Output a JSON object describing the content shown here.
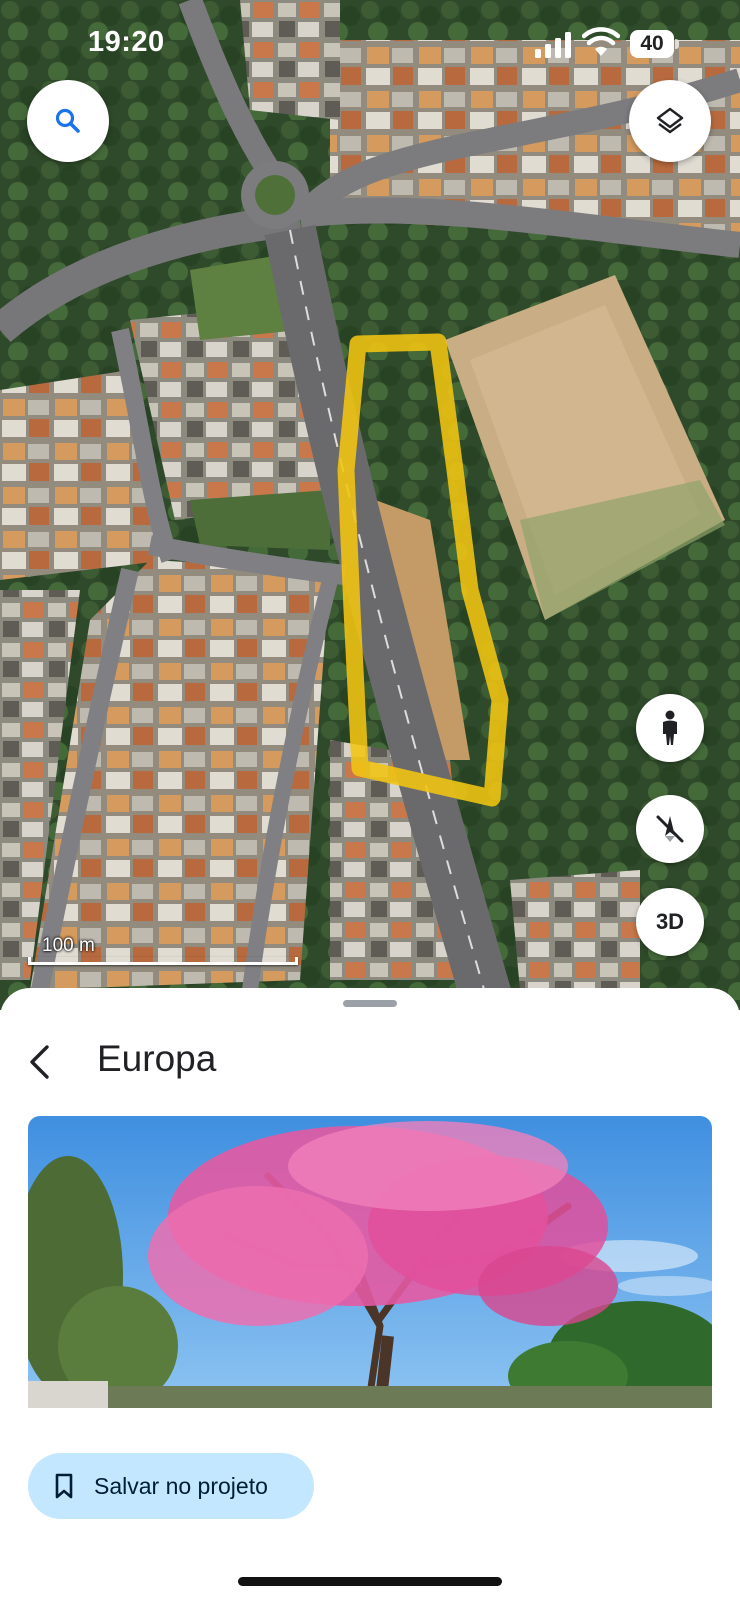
{
  "status_bar": {
    "time": "19:20",
    "battery_level": "40",
    "icons": [
      "signal-icon",
      "wifi-icon",
      "battery-icon"
    ]
  },
  "map": {
    "scale_label": "100 m",
    "controls": {
      "search": "search-icon",
      "layers": "layers-icon",
      "street_view": "pegman-icon",
      "north": "compass-icon",
      "view_3d_label": "3D"
    },
    "highlight_color": "#f2c511"
  },
  "sheet": {
    "title": "Europa",
    "photo": "pink-ipe-tree-photo",
    "save_button_label": "Salvar no projeto",
    "save_icon": "bookmark-icon",
    "accent_color": "#c2e7ff"
  }
}
